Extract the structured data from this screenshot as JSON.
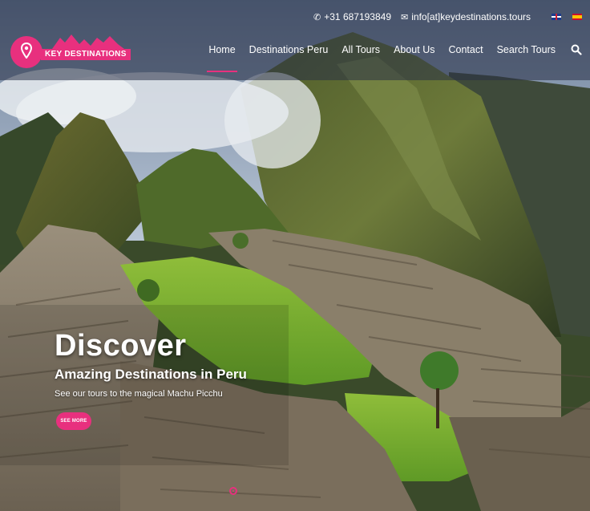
{
  "topbar": {
    "phone_icon": "phone-icon",
    "phone": "+31 687193849",
    "email_icon": "envelope-icon",
    "email": "info[at]keydestinations.tours",
    "languages": [
      "english-flag-icon",
      "spanish-flag-icon"
    ]
  },
  "logo": {
    "text": "KEY DESTINATIONS",
    "icon": "map-pin-icon"
  },
  "nav": {
    "items": [
      "Home",
      "Destinations Peru",
      "All Tours",
      "About Us",
      "Contact",
      "Search Tours"
    ],
    "active": "Home",
    "search_icon": "search-icon"
  },
  "hero": {
    "title": "Discover",
    "subtitle": "Amazing Destinations in Peru",
    "description": "See our tours to the magical Machu Picchu",
    "button_label": "SEE MORE"
  },
  "colors": {
    "accent": "#e8307e",
    "header_overlay": "#283046"
  }
}
